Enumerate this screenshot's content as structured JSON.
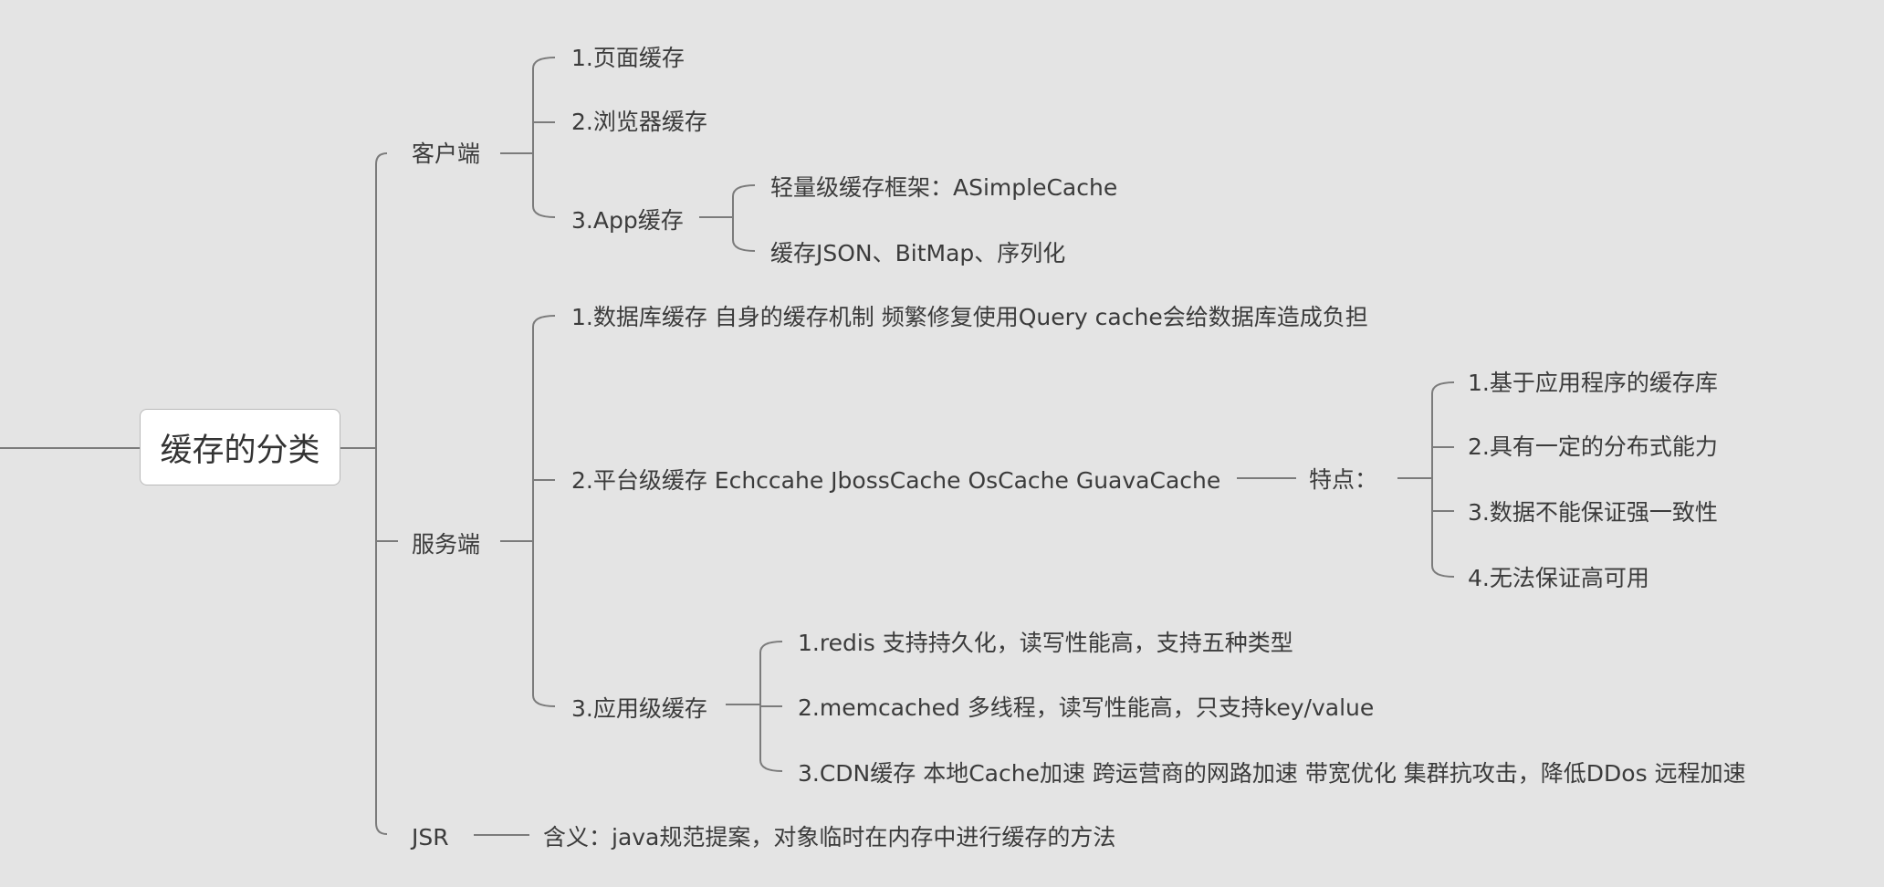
{
  "root": {
    "label": "缓存的分类"
  },
  "branches": {
    "client": {
      "label": "客户端",
      "items": [
        "1.页面缓存",
        "2.浏览器缓存",
        "3.App缓存"
      ],
      "app_children": [
        "轻量级缓存框架：ASimpleCache",
        "缓存JSON、BitMap、序列化"
      ]
    },
    "server": {
      "label": "服务端",
      "items": [
        "1.数据库缓存 自身的缓存机制 频繁修复使用Query cache会给数据库造成负担",
        "2.平台级缓存 Echccahe JbossCache OsCache GuavaCache",
        "3.应用级缓存"
      ],
      "platform_feature": {
        "label": "特点：",
        "items": [
          "1.基于应用程序的缓存库",
          "2.具有一定的分布式能力",
          "3.数据不能保证强一致性",
          "4.无法保证高可用"
        ]
      },
      "app_level_children": [
        "1.redis 支持持久化，读写性能高，支持五种类型",
        "2.memcached 多线程，读写性能高，只支持key/value",
        "3.CDN缓存 本地Cache加速 跨运营商的网路加速 带宽优化 集群抗攻击，降低DDos 远程加速"
      ]
    },
    "jsr": {
      "label": "JSR",
      "meaning": "含义：java规范提案，对象临时在内存中进行缓存的方法"
    }
  }
}
